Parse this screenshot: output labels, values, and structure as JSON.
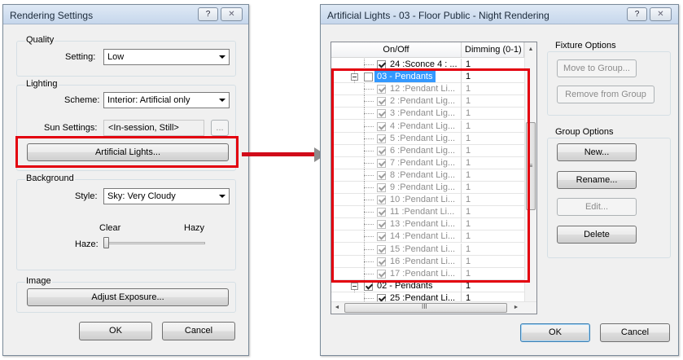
{
  "rendering_settings": {
    "title": "Rendering Settings",
    "help": "?",
    "close": "✕",
    "quality": {
      "group_label": "Quality",
      "setting_label": "Setting:",
      "setting_value": "Low"
    },
    "lighting": {
      "group_label": "Lighting",
      "scheme_label": "Scheme:",
      "scheme_value": "Interior: Artificial only",
      "sun_label": "Sun Settings:",
      "sun_value": "<In-session, Still>",
      "sun_button": "...",
      "artificial_button": "Artificial Lights..."
    },
    "background": {
      "group_label": "Background",
      "style_label": "Style:",
      "style_value": "Sky: Very Cloudy",
      "clear_label": "Clear",
      "hazy_label": "Hazy",
      "haze_label": "Haze:",
      "haze_level": 0.0
    },
    "image": {
      "group_label": "Image",
      "adjust_button": "Adjust Exposure..."
    },
    "ok": "OK",
    "cancel": "Cancel"
  },
  "artificial_lights": {
    "title": "Artificial Lights - 03 - Floor Public - Night Rendering",
    "help": "?",
    "close": "✕",
    "columns": [
      "On/Off",
      "Dimming (0-1)"
    ],
    "rows": [
      {
        "name": "24 :Sconce 4 : ...",
        "dimming": "1",
        "level": 2,
        "checked": true,
        "grey": false,
        "expander": false
      },
      {
        "name": "03 - Pendants",
        "dimming": "1",
        "level": 1,
        "checked": false,
        "grey": false,
        "expander": true,
        "selected": true
      },
      {
        "name": "12 :Pendant Li...",
        "dimming": "1",
        "level": 2,
        "checked": true,
        "grey": true,
        "expander": false
      },
      {
        "name": "2 :Pendant Lig...",
        "dimming": "1",
        "level": 2,
        "checked": true,
        "grey": true,
        "expander": false
      },
      {
        "name": "3 :Pendant Lig...",
        "dimming": "1",
        "level": 2,
        "checked": true,
        "grey": true,
        "expander": false
      },
      {
        "name": "4 :Pendant Lig...",
        "dimming": "1",
        "level": 2,
        "checked": true,
        "grey": true,
        "expander": false
      },
      {
        "name": "5 :Pendant Lig...",
        "dimming": "1",
        "level": 2,
        "checked": true,
        "grey": true,
        "expander": false
      },
      {
        "name": "6 :Pendant Lig...",
        "dimming": "1",
        "level": 2,
        "checked": true,
        "grey": true,
        "expander": false
      },
      {
        "name": "7 :Pendant Lig...",
        "dimming": "1",
        "level": 2,
        "checked": true,
        "grey": true,
        "expander": false
      },
      {
        "name": "8 :Pendant Lig...",
        "dimming": "1",
        "level": 2,
        "checked": true,
        "grey": true,
        "expander": false
      },
      {
        "name": "9 :Pendant Lig...",
        "dimming": "1",
        "level": 2,
        "checked": true,
        "grey": true,
        "expander": false
      },
      {
        "name": "10 :Pendant Li...",
        "dimming": "1",
        "level": 2,
        "checked": true,
        "grey": true,
        "expander": false
      },
      {
        "name": "11 :Pendant Li...",
        "dimming": "1",
        "level": 2,
        "checked": true,
        "grey": true,
        "expander": false
      },
      {
        "name": "13 :Pendant Li...",
        "dimming": "1",
        "level": 2,
        "checked": true,
        "grey": true,
        "expander": false
      },
      {
        "name": "14 :Pendant Li...",
        "dimming": "1",
        "level": 2,
        "checked": true,
        "grey": true,
        "expander": false
      },
      {
        "name": "15 :Pendant Li...",
        "dimming": "1",
        "level": 2,
        "checked": true,
        "grey": true,
        "expander": false
      },
      {
        "name": "16 :Pendant Li...",
        "dimming": "1",
        "level": 2,
        "checked": true,
        "grey": true,
        "expander": false
      },
      {
        "name": "17 :Pendant Li...",
        "dimming": "1",
        "level": 2,
        "checked": true,
        "grey": true,
        "expander": false
      },
      {
        "name": "02 - Pendants",
        "dimming": "1",
        "level": 1,
        "checked": true,
        "grey": false,
        "expander": true
      },
      {
        "name": "25 :Pendant Li...",
        "dimming": "1",
        "level": 2,
        "checked": true,
        "grey": false,
        "expander": false
      }
    ],
    "fixture_options": {
      "group_label": "Fixture Options",
      "move_button": "Move to Group...",
      "remove_button": "Remove from Group"
    },
    "group_options": {
      "group_label": "Group Options",
      "new_button": "New...",
      "rename_button": "Rename...",
      "edit_button": "Edit...",
      "delete_button": "Delete"
    },
    "hscroll_grip": "III",
    "ok": "OK",
    "cancel": "Cancel"
  },
  "annotation": {
    "color": "#e3000f",
    "arrow_head_color": "#8c8c8c"
  }
}
